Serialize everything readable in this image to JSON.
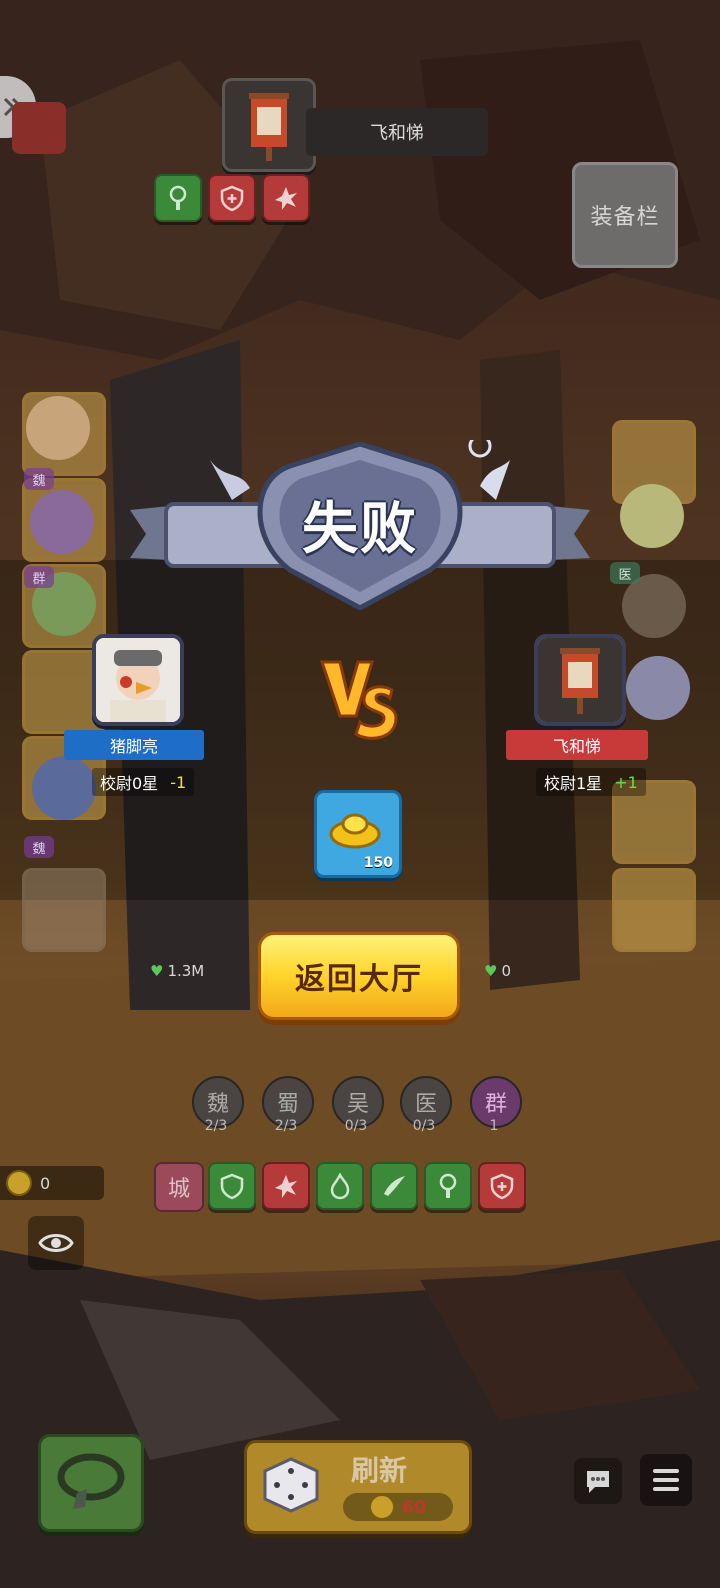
{
  "enemy_header": {
    "name": "飞和悌"
  },
  "equip_panel": {
    "label": "装备栏"
  },
  "result": {
    "title": "失败"
  },
  "player_left": {
    "name": "猪脚亮",
    "rank": "校尉0星",
    "delta": "-1",
    "name_color": "#1e6ec8"
  },
  "player_right": {
    "name": "飞和悌",
    "rank": "校尉1星",
    "delta": "+1",
    "name_color": "#c83a3a"
  },
  "reward": {
    "icon": "gold-ingot-icon",
    "count": "150"
  },
  "return_button": {
    "label": "返回大厅"
  },
  "hp": {
    "left": "1.3M",
    "right": "0"
  },
  "factions": [
    {
      "name": "魏",
      "count": "2/3"
    },
    {
      "name": "蜀",
      "count": "2/3"
    },
    {
      "name": "吴",
      "count": "0/3"
    },
    {
      "name": "医",
      "count": "0/3"
    },
    {
      "name": "群",
      "count": "1"
    }
  ],
  "gold": {
    "amount": "0"
  },
  "city": {
    "label": "城"
  },
  "refresh": {
    "label": "刷新",
    "cost": "60"
  },
  "side_tags": {
    "wei": "魏",
    "qun": "群",
    "yi": "医"
  },
  "colors": {
    "accent_gold": "#ffd42a",
    "win_green": "#62e04a",
    "lose_yellow": "#f2e24a"
  }
}
